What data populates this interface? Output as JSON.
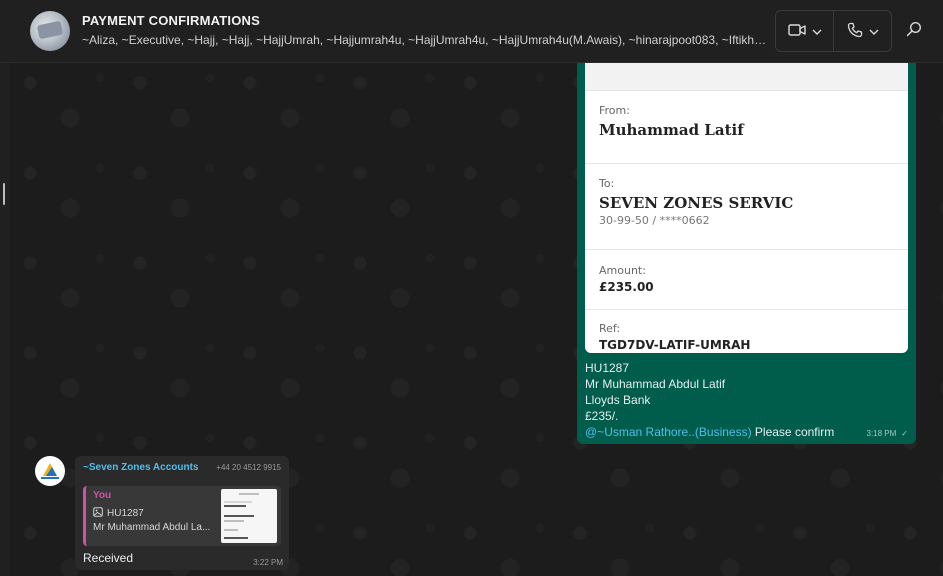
{
  "header": {
    "title": "PAYMENT CONFIRMATIONS",
    "members": "~Aliza, ~Executive, ~Hajj, ~Hajj, ~HajjUmrah, ~Hajjumrah4u, ~HajjUmrah4u, ~HajjUmrah4u(M.Awais), ~hinarajpoot083, ~Iftikh…",
    "video_icon": "video-camera-icon",
    "call_icon": "phone-icon",
    "search_icon": "search-icon"
  },
  "outgoing": {
    "receipt": {
      "from_label": "From:",
      "from_name": "Muhammad Latif",
      "to_label": "To:",
      "to_name": "SEVEN ZONES SERVIC",
      "to_account": "30-99-50 / ****0662",
      "amount_label": "Amount:",
      "amount": "£235.00",
      "ref_label": "Ref:",
      "ref": "TGD7DV-LATIF-UMRAH"
    },
    "caption": {
      "line1": "HU1287",
      "line2": "Mr Muhammad Abdul Latif",
      "line3": "Lloyds Bank",
      "line4": "£235/.",
      "mention": "@~Usman Rathore..(Business)",
      "rest": " Please confirm"
    },
    "time": "3:18 PM",
    "status": "✓"
  },
  "incoming": {
    "sender_name": "~Seven Zones Accounts",
    "sender_phone": "+44 20 4512 9915",
    "quote": {
      "author": "You",
      "line1": "HU1287",
      "line2": "Mr Muhammad Abdul La..."
    },
    "text": "Received",
    "time": "3:22 PM"
  },
  "colors": {
    "outgoing_bubble": "#005c4b",
    "incoming_bubble": "#2a2a2a",
    "mention": "#53bdeb",
    "quote_accent": "#d052a8"
  }
}
